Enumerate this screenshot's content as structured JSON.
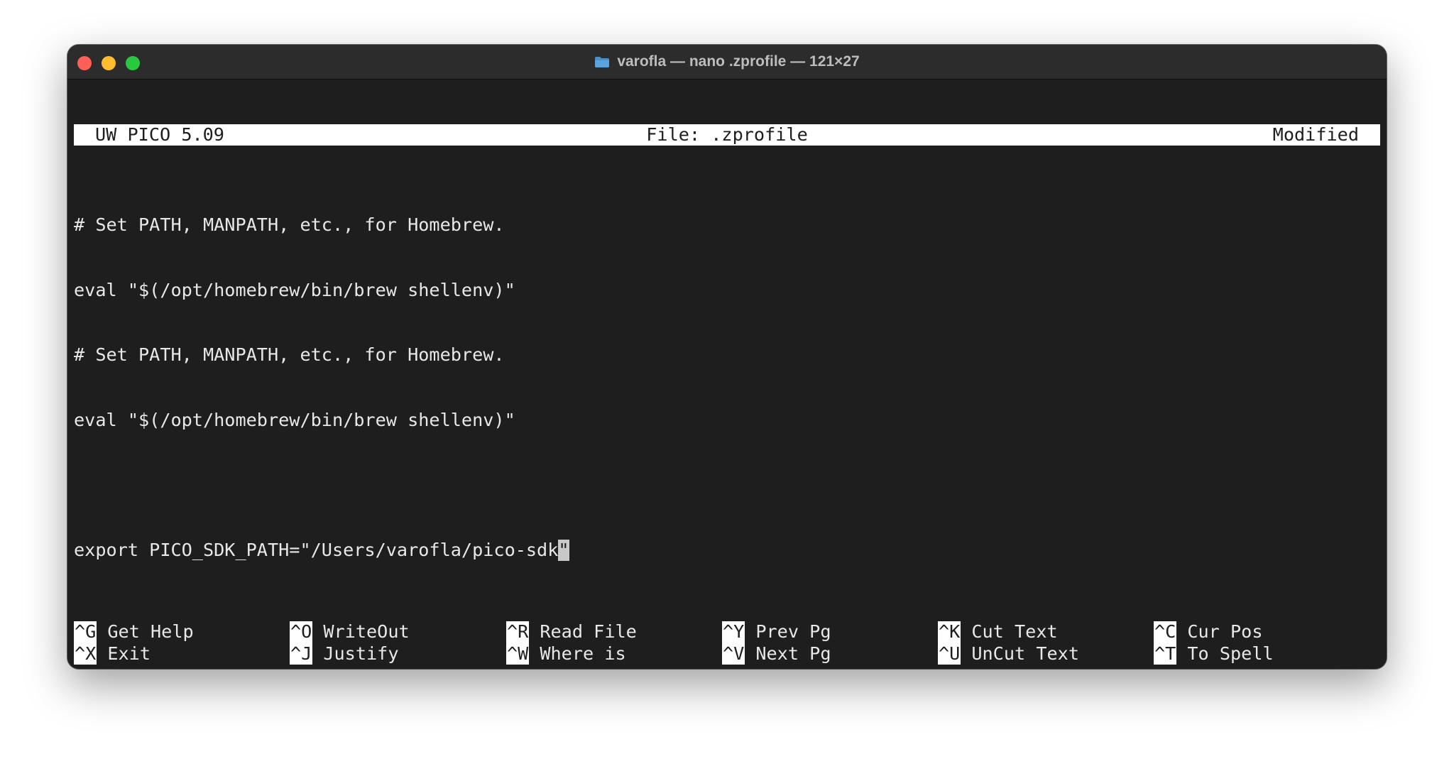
{
  "window": {
    "title": "varofla — nano .zprofile — 121×27"
  },
  "icons": {
    "close": "close-traffic-light",
    "minimize": "minimize-traffic-light",
    "maximize": "maximize-traffic-light",
    "folder": "folder-icon"
  },
  "colors": {
    "close": "#fe5f57",
    "minimize": "#febc2e",
    "maximize": "#28c840",
    "terminal_bg": "#1e1e1e",
    "terminal_fg": "#e8e8e8"
  },
  "status": {
    "app": "UW PICO 5.09",
    "file": "File: .zprofile",
    "state": "Modified"
  },
  "editor": {
    "lines": [
      "# Set PATH, MANPATH, etc., for Homebrew.",
      "eval \"$(/opt/homebrew/bin/brew shellenv)\"",
      "# Set PATH, MANPATH, etc., for Homebrew.",
      "eval \"$(/opt/homebrew/bin/brew shellenv)\"",
      "",
      "export PICO_SDK_PATH=\"/Users/varofla/pico-sdk"
    ],
    "cursor_char": "\""
  },
  "shortcuts": {
    "row1": [
      {
        "key": "^G",
        "label": "Get Help"
      },
      {
        "key": "^O",
        "label": "WriteOut"
      },
      {
        "key": "^R",
        "label": "Read File"
      },
      {
        "key": "^Y",
        "label": "Prev Pg"
      },
      {
        "key": "^K",
        "label": "Cut Text"
      },
      {
        "key": "^C",
        "label": "Cur Pos"
      }
    ],
    "row2": [
      {
        "key": "^X",
        "label": "Exit"
      },
      {
        "key": "^J",
        "label": "Justify"
      },
      {
        "key": "^W",
        "label": "Where is"
      },
      {
        "key": "^V",
        "label": "Next Pg"
      },
      {
        "key": "^U",
        "label": "UnCut Text"
      },
      {
        "key": "^T",
        "label": "To Spell"
      }
    ]
  }
}
